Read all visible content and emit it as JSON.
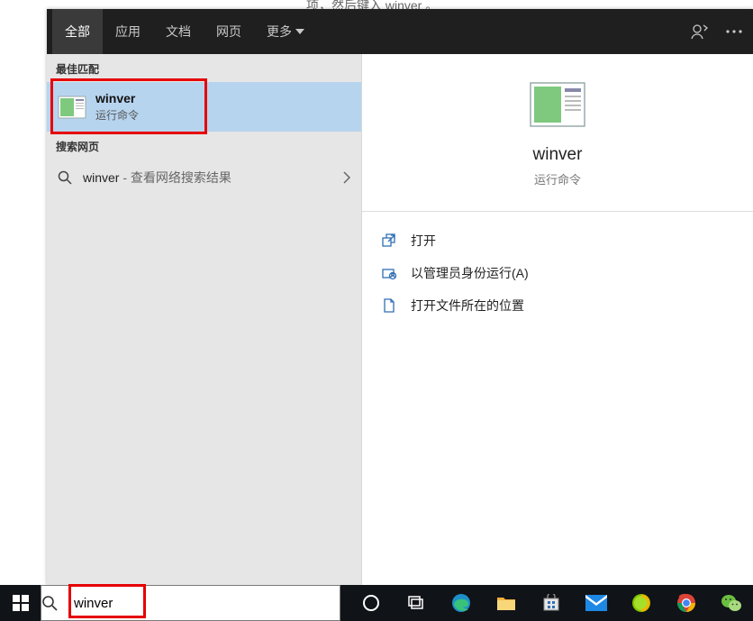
{
  "header": {
    "tabs": [
      "全部",
      "应用",
      "文档",
      "网页",
      "更多"
    ]
  },
  "left": {
    "best_match_header": "最佳匹配",
    "best_match": {
      "title": "winver",
      "subtitle": "运行命令"
    },
    "web_header": "搜索网页",
    "web_item": {
      "title": "winver",
      "suffix": " - 查看网络搜索结果"
    }
  },
  "detail": {
    "title": "winver",
    "subtitle": "运行命令",
    "actions": [
      "打开",
      "以管理员身份运行(A)",
      "打开文件所在的位置"
    ]
  },
  "search": {
    "value": "winver"
  },
  "fragment_above": "项，然后键入  winver 。"
}
